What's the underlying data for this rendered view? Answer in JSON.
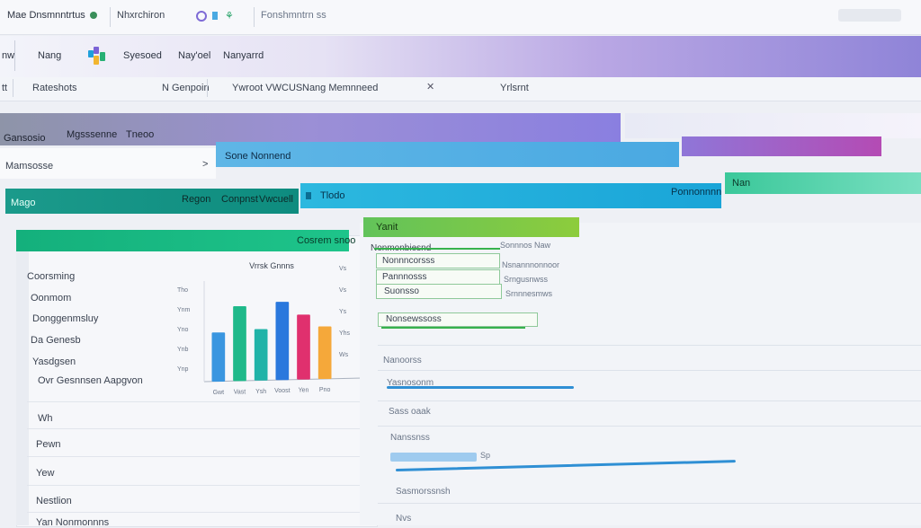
{
  "topbar": {
    "app_title": "Mae Dnsmnntrtus",
    "tab_label": "Nhxrchiron",
    "search_hint": "Fonshmntrn ss"
  },
  "nav": {
    "left_label": "nw",
    "items": [
      "Nang",
      "Syesoed",
      "Nay'oel",
      "Nanyarrd"
    ]
  },
  "subnav": {
    "left": "tt",
    "item1": "Rateshots",
    "item2": "N Genpoin",
    "item3": "Ywroot VWCUS",
    "item4": "Nang Memnneed",
    "item5": "Yrlsrnt"
  },
  "strip": {
    "label1": "Gansosio",
    "label2": "Mgsssenne",
    "label3": "Tneoo"
  },
  "breadcrumb": {
    "text": "Mamsosse",
    "chevron": ">",
    "blue_label": "Sone Nonnend"
  },
  "toolbar": {
    "left": "Mago",
    "b1": "Regon",
    "b2": "Conpnst",
    "b3": "Vwcuell",
    "b4": "Tlodo",
    "right_label": "Ponnonnnn",
    "green_tag": "Nan"
  },
  "panel": {
    "header": "Cosrem snoo",
    "rows": [
      "Coorsming",
      "Oonmom",
      "Donggenmsluy",
      "Da Genesb",
      "Yasdgsen",
      "Ovr Gesnnsen Aapgvon"
    ],
    "lower_rows": [
      "Wh",
      "Pewn",
      "Yew",
      "Nestlion",
      "Yan Nonmonnns"
    ]
  },
  "chart_data": {
    "type": "bar",
    "title": "Vrrsk Gnnns",
    "categories": [
      "Gwt",
      "Vast",
      "Ysh",
      "Voost",
      "Yen",
      "Pno"
    ],
    "values": [
      44,
      67,
      46,
      70,
      58,
      47
    ],
    "ylim": [
      0,
      90
    ],
    "y_ticks": [
      "Tho",
      "Ynm",
      "Yno",
      "Ynb",
      "Ynp"
    ],
    "right_ticks": [
      "Vs",
      "Vs",
      "Ys",
      "Yhs",
      "Ws"
    ],
    "colors": [
      "#3a96e0",
      "#1fb98a",
      "#20b3a8",
      "#2a78dd",
      "#e0306e",
      "#f5a83a"
    ]
  },
  "rightpanel": {
    "header": "Yanit",
    "list": [
      {
        "label": "Nonmonbiesnd",
        "meta": "Sonnnos Naw"
      },
      {
        "label": "Nonnncorsss",
        "meta": "Nsnannnonnoor"
      },
      {
        "label": "Pannnosss",
        "meta": "Srngusnwss"
      },
      {
        "label": "Suonsso",
        "meta": "Srnnnesmws"
      },
      {
        "label": "Nonsewssoss",
        "meta": ""
      }
    ],
    "lower": [
      "Nanoorss",
      "Yasnosonm",
      "Sass oaak",
      "Nanssnss",
      "Sp",
      "Sasmorssnsh",
      "Nvs"
    ]
  },
  "colors": {
    "accent_green": "#1ec48a",
    "accent_blue": "#2f8fd4",
    "accent_purple": "#8a7fe0"
  }
}
